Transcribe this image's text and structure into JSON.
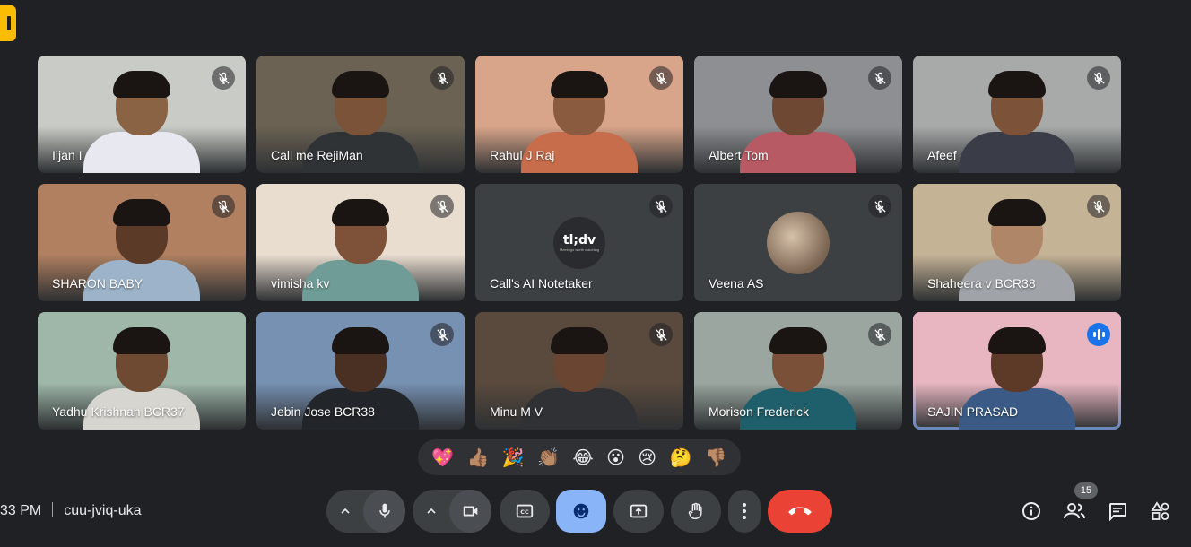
{
  "meeting": {
    "time": "33 PM",
    "code": "cuu-jviq-uka"
  },
  "participants": [
    {
      "name": "Iijan I",
      "muted": true,
      "bg": "#c9ccc6",
      "skin": "#8a6244",
      "shirt": "#e8e8f0"
    },
    {
      "name": "Call me RejiMan",
      "muted": true,
      "bg": "#6b6253",
      "skin": "#7a5338",
      "shirt": "#2f3336"
    },
    {
      "name": "Rahul J Raj",
      "muted": true,
      "bg": "#d9a58a",
      "skin": "#8b5b3f",
      "shirt": "#c76d4b"
    },
    {
      "name": "Albert Tom",
      "muted": true,
      "bg": "#8d8f92",
      "skin": "#6e4833",
      "shirt": "#b85a63"
    },
    {
      "name": "Afeef",
      "muted": true,
      "bg": "#a7aaa9",
      "skin": "#7c5238",
      "shirt": "#3a3d47"
    },
    {
      "name": "SHARON BABY",
      "muted": true,
      "bg": "#b08060",
      "skin": "#5c3a28",
      "shirt": "#9db3c9"
    },
    {
      "name": "vimisha kv",
      "muted": true,
      "bg": "#e9ddd0",
      "skin": "#7d5238",
      "shirt": "#6f9c97"
    },
    {
      "name": "Call's AI Notetaker",
      "muted": true,
      "type": "notetaker",
      "logo": "tl;dv",
      "tagline": "Meetings worth watching"
    },
    {
      "name": "Veena AS",
      "muted": true,
      "type": "avatar"
    },
    {
      "name": "Shaheera v BCR38",
      "muted": true,
      "bg": "#c5b396",
      "skin": "#b08669",
      "shirt": "#a0a4a8"
    },
    {
      "name": "Yadhu Krishnan BCR37",
      "muted": false,
      "bg": "#9fb7a9",
      "skin": "#6f4a33",
      "shirt": "#d6d5cf"
    },
    {
      "name": "Jebin Jose BCR38",
      "muted": true,
      "bg": "#7791b3",
      "skin": "#4a3022",
      "shirt": "#22252a"
    },
    {
      "name": "Minu M V",
      "muted": true,
      "bg": "#5a4a3d",
      "skin": "#6a4532",
      "shirt": "#303134"
    },
    {
      "name": "Morison Frederick",
      "muted": true,
      "bg": "#9aa69f",
      "skin": "#7a5038",
      "shirt": "#1f5f6b"
    },
    {
      "name": "SAJIN PRASAD",
      "muted": false,
      "speaking": true,
      "bg": "#e8b6c0",
      "skin": "#5d3a27",
      "shirt": "#3b5b86"
    }
  ],
  "reactions": [
    "💖",
    "👍🏽",
    "🎉",
    "👏🏽",
    "😂",
    "😮",
    "😢",
    "🤔",
    "👎🏽"
  ],
  "people_count": "15",
  "icons": {
    "mic": "mic-icon",
    "camera": "videocam-icon",
    "captions": "closed-caption-icon",
    "emoji": "emoji-icon",
    "present": "present-screen-icon",
    "hand": "raise-hand-icon",
    "more": "more-vert-icon",
    "hangup": "call-end-icon",
    "info": "info-icon",
    "people": "people-icon",
    "chat": "chat-icon",
    "activities": "activities-icon"
  },
  "colors": {
    "background": "#202124",
    "accent": "#8ab4f8",
    "hangup": "#ea4335",
    "speaking": "#1a73e8"
  }
}
